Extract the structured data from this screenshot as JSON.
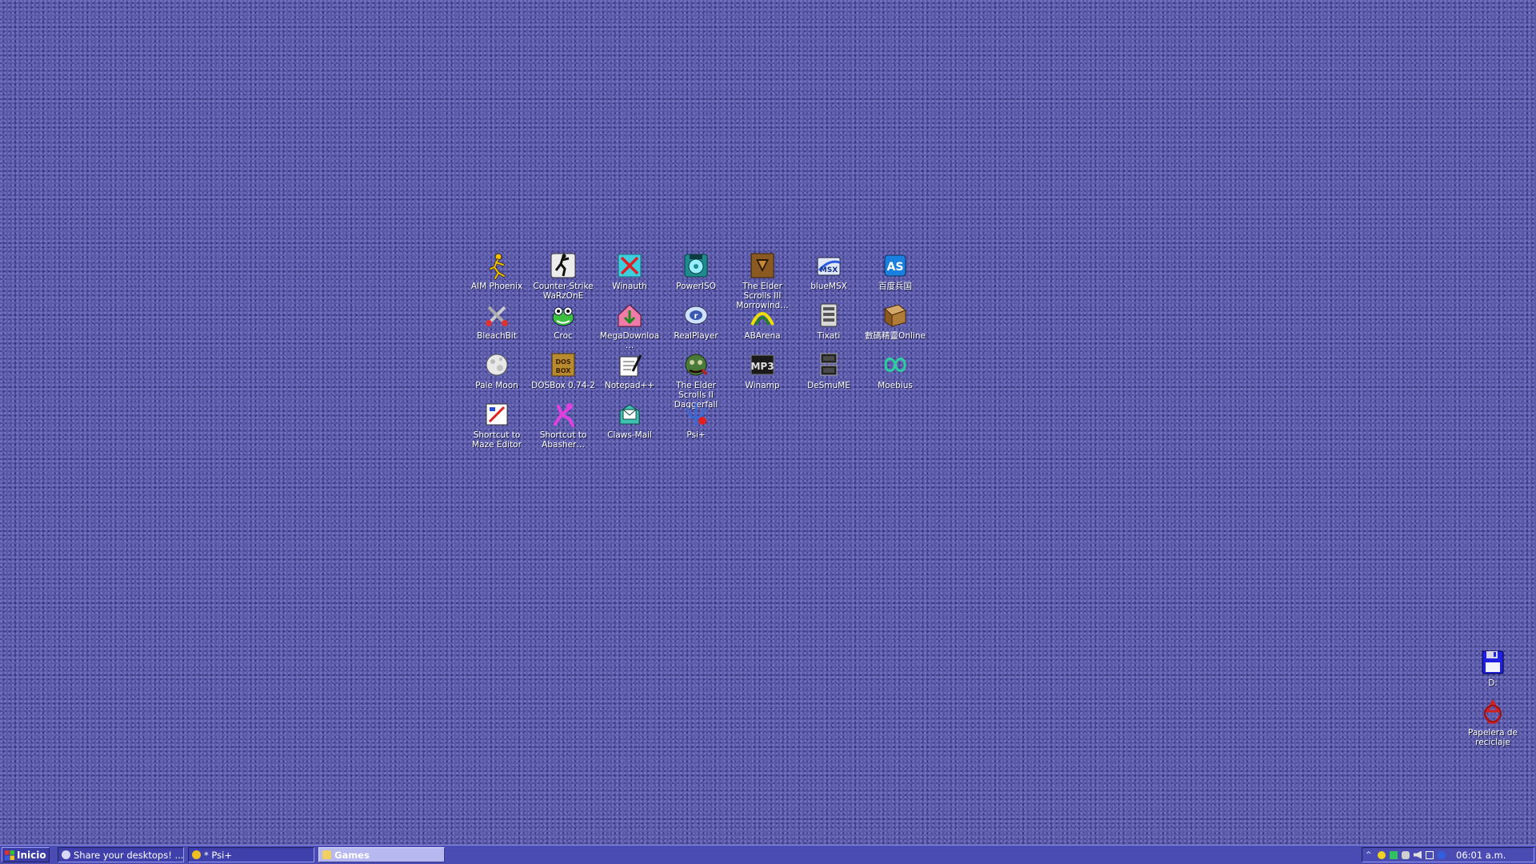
{
  "desktop": {
    "icons": [
      {
        "label": "AIM Phoenix",
        "icon": "running-man-icon"
      },
      {
        "label": "Counter-Strike WaRzOnE",
        "icon": "counter-strike-icon"
      },
      {
        "label": "Winauth",
        "icon": "winauth-icon"
      },
      {
        "label": "PowerISO",
        "icon": "poweriso-icon"
      },
      {
        "label": "The Elder Scrolls III Morrowind…",
        "icon": "morrowind-icon"
      },
      {
        "label": "blueMSX",
        "icon": "bluemsx-icon"
      },
      {
        "label": "百度兵国",
        "icon": "as-game-icon"
      },
      {
        "label": "BleachBit",
        "icon": "bleachbit-icon"
      },
      {
        "label": "Croc",
        "icon": "croc-icon"
      },
      {
        "label": "MegaDownloa…",
        "icon": "megadownload-icon"
      },
      {
        "label": "RealPlayer",
        "icon": "realplayer-icon"
      },
      {
        "label": "ABArena",
        "icon": "abarena-icon"
      },
      {
        "label": "Tixati",
        "icon": "tixati-icon"
      },
      {
        "label": "數碼精靈Online",
        "icon": "book-game-icon"
      },
      {
        "label": "Pale Moon",
        "icon": "pale-moon-icon"
      },
      {
        "label": "DOSBox 0.74-2",
        "icon": "dosbox-icon"
      },
      {
        "label": "Notepad++",
        "icon": "notepadpp-icon"
      },
      {
        "label": "The Elder Scrolls II Daggerfall",
        "icon": "daggerfall-icon"
      },
      {
        "label": "Winamp",
        "icon": "winamp-icon"
      },
      {
        "label": "DeSmuME",
        "icon": "desmume-icon"
      },
      {
        "label": "Moebius",
        "icon": "moebius-icon"
      },
      {
        "label": "Shortcut to Maze Editor",
        "icon": "maze-editor-icon"
      },
      {
        "label": "Shortcut to Abasher…",
        "icon": "abasher-icon"
      },
      {
        "label": "Claws-Mail",
        "icon": "claws-mail-icon"
      },
      {
        "label": "Psi+",
        "icon": "psi-icon"
      }
    ],
    "right_icons": [
      {
        "label": "D:",
        "icon": "floppy-disk-icon"
      },
      {
        "label": "Papelera de reciclaje",
        "icon": "recycle-bin-icon"
      }
    ]
  },
  "taskbar": {
    "start_label": "Inicio",
    "tasks": [
      {
        "label": "Share your desktops! ...",
        "active": false,
        "icon": "browser-icon"
      },
      {
        "label": "* Psi+",
        "active": false,
        "icon": "psi-icon"
      },
      {
        "label": "Games",
        "active": true,
        "icon": "folder-icon"
      }
    ],
    "clock": "06:01 a.m.",
    "tray_icons": [
      "chevron-up-icon",
      "star-icon",
      "network-icon",
      "people-icon",
      "volume-icon",
      "display-icon",
      "language-icon"
    ]
  },
  "colors": {
    "desktop_bg": "#5a5aa8",
    "taskbar_bg": "#4b4bb4",
    "active_task": "#b8b8f0"
  }
}
